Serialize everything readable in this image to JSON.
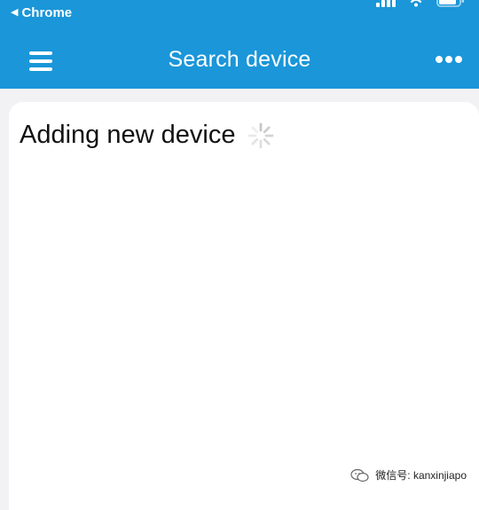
{
  "status_bar": {
    "back_label": "Chrome",
    "back_icon": "back-triangle-icon",
    "icons": [
      "signal-icon",
      "wifi-icon",
      "battery-icon"
    ]
  },
  "toolbar": {
    "title": "Search device",
    "menu_icon": "hamburger-menu-icon",
    "more_icon": "more-dots-icon"
  },
  "card": {
    "title": "Adding new device",
    "loading_icon": "spinner-icon"
  },
  "watermark": {
    "text": "微信号: kanxinjiapo",
    "icon": "wechat-logo-icon"
  },
  "colors": {
    "header_bg": "#1a96d9",
    "page_bg": "#f2f2f4",
    "card_bg": "#ffffff",
    "spinner": "#c8c8c8"
  }
}
